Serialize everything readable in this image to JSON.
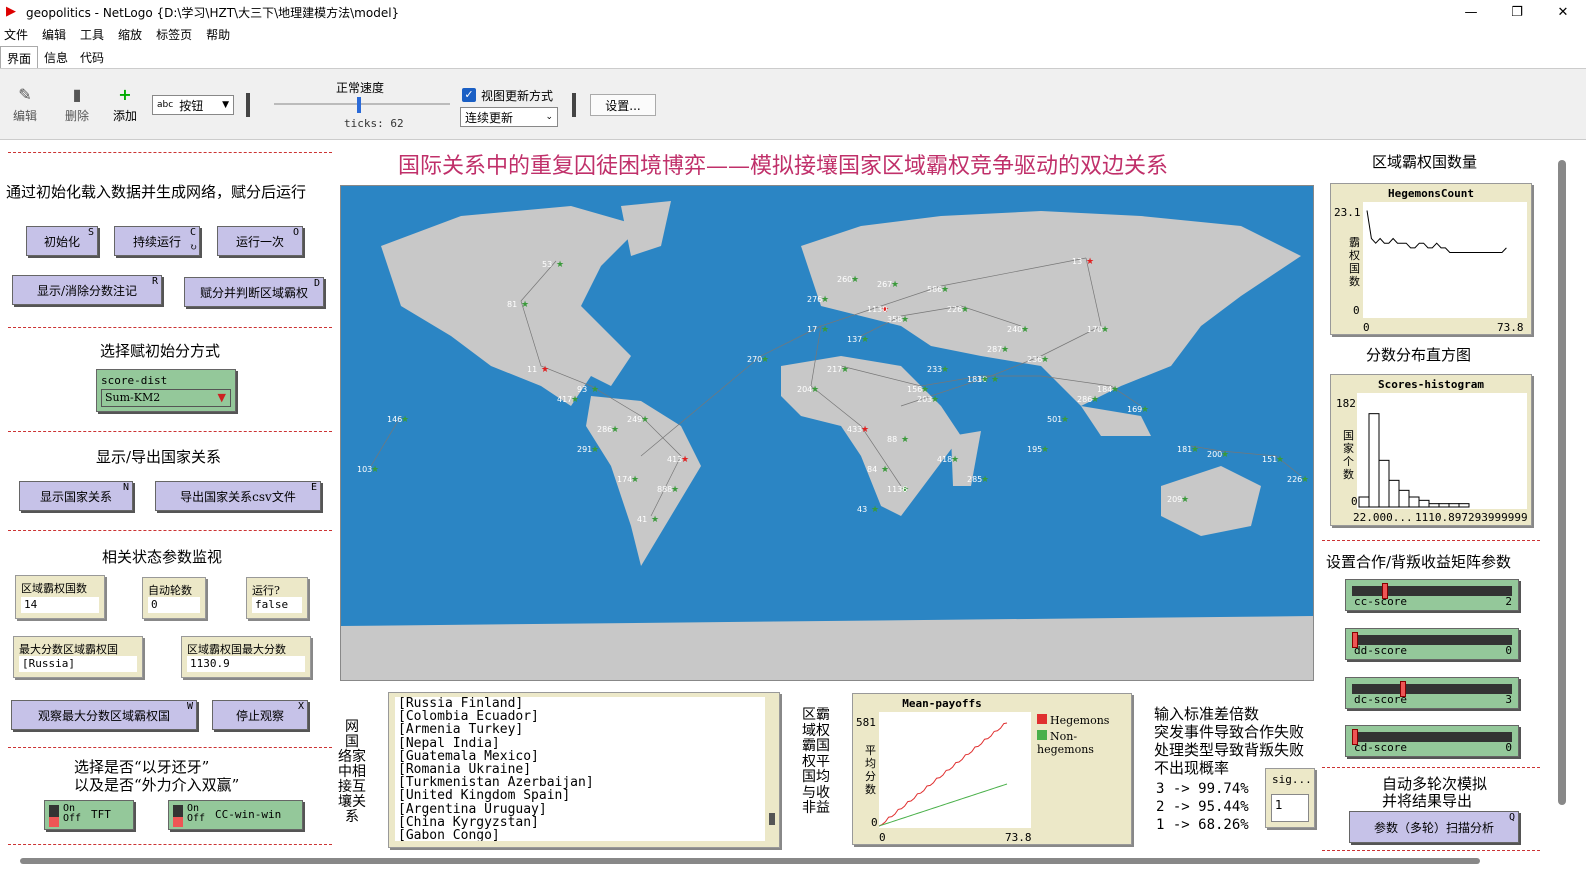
{
  "window": {
    "title": "geopolitics - NetLogo {D:\\学习\\HZT\\大三下\\地理建模方法\\model}",
    "min": "—",
    "max": "❐",
    "close": "✕"
  },
  "menu": [
    "文件",
    "编辑",
    "工具",
    "缩放",
    "标签页",
    "帮助"
  ],
  "tabs": [
    "界面",
    "信息",
    "代码"
  ],
  "toolbar": {
    "edit": "编辑",
    "delete": "删除",
    "add": "添加",
    "widget_type": "按钮",
    "speed_label": "正常速度",
    "ticks": "ticks: 62",
    "view_update_label": "视图更新方式",
    "view_update_mode": "连续更新",
    "settings": "设置..."
  },
  "heading": "国际关系中的重复囚徒困境博弈——模拟接壤国家区域霸权竞争驱动的双边关系",
  "left": {
    "intro": "通过初始化载入数据并生成网络，赋分后运行",
    "btn_setup": "初始化",
    "key_setup": "S",
    "btn_go": "持续运行",
    "key_go": "C",
    "btn_go_once": "运行一次",
    "key_go_once": "O",
    "btn_show_score": "显示/消除分数注记",
    "key_show_score": "R",
    "btn_assign": "赋分并判断区域霸权",
    "key_assign": "D",
    "init_label": "选择赋初始分方式",
    "chooser_name": "score-dist",
    "chooser_value": "Sum-KM2",
    "rel_label": "显示/导出国家关系",
    "btn_show_rel": "显示国家关系",
    "key_show_rel": "N",
    "btn_export": "导出国家关系csv文件",
    "key_export": "E",
    "monitor_label": "相关状态参数监视",
    "mon1_t": "区域霸权国数",
    "mon1_v": "14",
    "mon2_t": "自动轮数",
    "mon2_v": "0",
    "mon3_t": "运行?",
    "mon3_v": "false",
    "mon4_t": "最大分数区域霸权国",
    "mon4_v": "[Russia]",
    "mon5_t": "区域霸权国最大分数",
    "mon5_v": "1130.9",
    "btn_watch": "观察最大分数区域霸权国",
    "key_watch": "W",
    "btn_stop": "停止观察",
    "key_stop": "X",
    "choose1": "选择是否“以牙还牙”",
    "choose2": "以及是否“外力介入双赢”",
    "sw_on": "On",
    "sw_off": "Off",
    "sw1": "TFT",
    "sw2": "CC-win-win"
  },
  "relations_label": [
    "网",
    "国",
    "络家",
    "中相",
    "接互",
    "壤关",
    "系"
  ],
  "relations": [
    "[Russia Finland]",
    "[Colombia Ecuador]",
    "[Armenia Turkey]",
    "[Nepal India]",
    "[Guatemala Mexico]",
    "[Romania Ukraine]",
    "[Turkmenistan Azerbaijan]",
    "[United Kingdom Spain]",
    "[Argentina Uruguay]",
    "[China Kyrgyzstan]",
    "[Gabon Congo]"
  ],
  "payoff_label": [
    "区霸",
    "域权",
    "霸国",
    "权平",
    "国均",
    "与收",
    "非益"
  ],
  "mean_plot": {
    "title": "Mean-payoffs",
    "ymax": "581",
    "ymin": "0",
    "xmin": "0",
    "xmax": "73.8",
    "ylabel": [
      "平",
      "均",
      "分",
      "数"
    ],
    "legend": [
      "Hegemons",
      "Non-hegemons"
    ],
    "hegemon_color": "#e03030",
    "non_color": "#4ab04a"
  },
  "sigma": {
    "lines": [
      "输入标准差倍数",
      "突发事件导致合作失败",
      "处理类型导致背叛失败",
      "不出现概率"
    ],
    "rows": [
      "3 -> 99.74%",
      "2 -> 95.44%",
      "1 -> 68.26%"
    ],
    "input_name": "sig...",
    "input_value": "1"
  },
  "right": {
    "hegemon_label": "区域霸权国数量",
    "hc_title": "HegemonsCount",
    "hc_ymax": "23.1",
    "hc_ymin": "0",
    "hc_xmin": "0",
    "hc_xmax": "73.8",
    "hc_ylabel": [
      "霸",
      "权",
      "国",
      "数"
    ],
    "hist_label": "分数分布直方图",
    "hist_title": "Scores-histogram",
    "hist_ymax": "182",
    "hist_ymin": "0",
    "hist_xmin": "22.000...",
    "hist_xmax": "1110.897293999999",
    "hist_ylabel": [
      "国",
      "家",
      "个",
      "数"
    ],
    "matrix_label": "设置合作/背叛收益矩阵参数",
    "sl_cc": "cc-score",
    "sl_cc_v": "2",
    "sl_dd": "dd-score",
    "sl_dd_v": "0",
    "sl_dc": "dc-score",
    "sl_dc_v": "3",
    "sl_cd": "cd-score",
    "sl_cd_v": "0",
    "auto1": "自动多轮次模拟",
    "auto2": "并将结果导出",
    "btn_scan": "参数（多轮）扫描分析",
    "key_scan": "Q"
  },
  "hegemons_series": [
    23,
    17,
    16,
    17,
    16,
    16,
    17,
    16,
    16,
    16,
    15,
    15,
    16,
    16,
    15,
    15,
    16,
    15,
    15,
    14,
    14,
    14,
    14,
    14,
    14,
    14,
    14,
    14,
    14,
    14,
    14,
    14,
    15
  ],
  "hist_values": [
    3,
    28,
    14,
    8,
    5,
    3,
    2,
    1,
    1,
    1,
    1,
    0,
    0,
    0,
    0,
    0
  ],
  "map_labels": [
    "53",
    "81",
    "11",
    "93",
    "249",
    "413",
    "41",
    "13",
    "586",
    "1130",
    "17",
    "204",
    "433",
    "1136",
    "170",
    "236",
    "30",
    "156",
    "181",
    "184",
    "169",
    "103",
    "146",
    "137",
    "358",
    "226",
    "240",
    "181",
    "200",
    "151",
    "226",
    "209",
    "217",
    "270",
    "276",
    "260",
    "267",
    "233",
    "88",
    "84",
    "43",
    "203",
    "286",
    "291",
    "174",
    "888",
    "417",
    "418",
    "285",
    "195",
    "501",
    "286",
    "287"
  ]
}
